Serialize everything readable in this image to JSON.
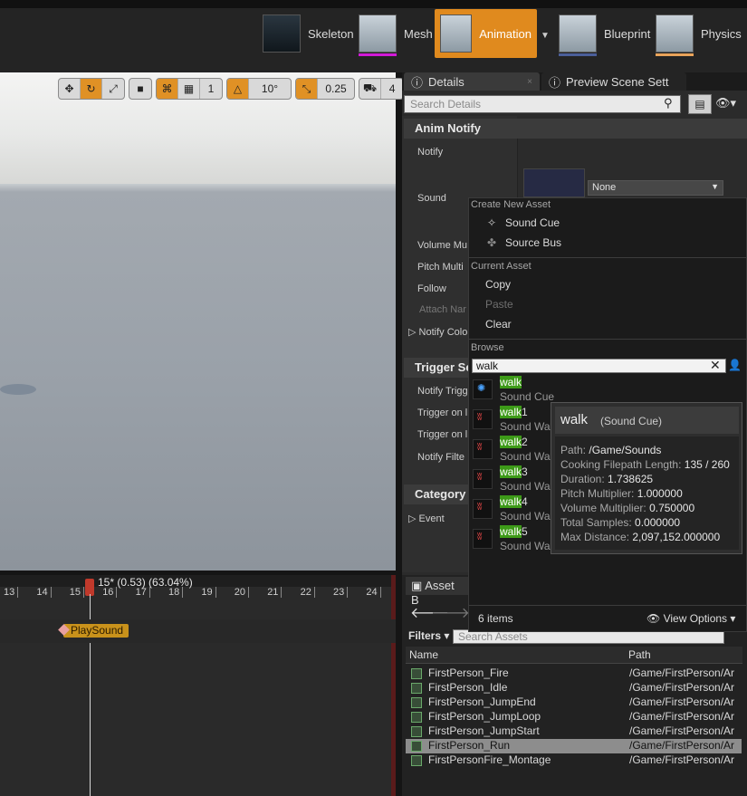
{
  "modes": [
    {
      "label": "Skeleton",
      "accent": "#33a3c8",
      "active": false
    },
    {
      "label": "Mesh",
      "accent": "#d21ad8",
      "active": false
    },
    {
      "label": "Animation",
      "accent": "#e08a1e",
      "active": true
    },
    {
      "label": "Blueprint",
      "accent": "#4b5f9a",
      "active": false
    },
    {
      "label": "Physics",
      "accent": "#e9a35a",
      "active": false
    }
  ],
  "viewport_toolbar": {
    "grid_count": "1",
    "angle": "10°",
    "scale": "0.25",
    "speed": "4"
  },
  "tabs": {
    "details": "Details",
    "preview": "Preview Scene Sett"
  },
  "details": {
    "search_placeholder": "Search Details",
    "sections": {
      "anim_notify": "Anim Notify",
      "trigger": "Trigger Se",
      "category": "Category"
    },
    "props": {
      "notify": "Notify",
      "sound": "Sound",
      "sound_value": "None",
      "volume": "Volume Mu",
      "pitch": "Pitch Multi",
      "follow": "Follow",
      "attach": "Attach Nar",
      "notify_color": "Notify Colo",
      "notify_trigger": "Notify Trigg",
      "trigger_on1": "Trigger on l",
      "trigger_on2": "Trigger on l",
      "notify_filter": "Notify Filte",
      "event": "Event"
    }
  },
  "menu": {
    "create_header": "Create New Asset",
    "sound_cue": "Sound Cue",
    "source_bus": "Source Bus",
    "current_header": "Current Asset",
    "copy": "Copy",
    "paste": "Paste",
    "clear": "Clear",
    "browse_header": "Browse",
    "filter_value": "walk",
    "assets": [
      {
        "hl": "walk",
        "rest": "",
        "type": "Sound Cue"
      },
      {
        "hl": "walk",
        "rest": "1",
        "type": "Sound Wa"
      },
      {
        "hl": "walk",
        "rest": "2",
        "type": "Sound Wa"
      },
      {
        "hl": "walk",
        "rest": "3",
        "type": "Sound Wa"
      },
      {
        "hl": "walk",
        "rest": "4",
        "type": "Sound Wa"
      },
      {
        "hl": "walk",
        "rest": "5",
        "type": "Sound Wa"
      }
    ],
    "count": "6 items",
    "view_options": "View Options"
  },
  "tooltip": {
    "name": "walk",
    "type": "(Sound Cue)",
    "rows": [
      {
        "k": "Path:",
        "v": "/Game/Sounds"
      },
      {
        "k": "Cooking Filepath Length:",
        "v": "135 / 260"
      },
      {
        "k": "Duration:",
        "v": "1.738625"
      },
      {
        "k": "Pitch Multiplier:",
        "v": "1.000000"
      },
      {
        "k": "Volume Multiplier:",
        "v": "0.750000"
      },
      {
        "k": "Total Samples:",
        "v": "0.000000"
      },
      {
        "k": "Max Distance:",
        "v": "2,097,152.000000"
      }
    ]
  },
  "timeline": {
    "playhead": "15* (0.53) (63.04%)",
    "ticks": [
      "13",
      "14",
      "15",
      "16",
      "17",
      "18",
      "19",
      "20",
      "21",
      "22",
      "23",
      "24"
    ],
    "notify": "PlaySound"
  },
  "asset_browser": {
    "title": "Asset B",
    "filters": "Filters",
    "search_placeholder": "Search Assets",
    "col_name": "Name",
    "col_path": "Path",
    "rows": [
      {
        "name": "FirstPerson_Fire",
        "path": "/Game/FirstPerson/Ar"
      },
      {
        "name": "FirstPerson_Idle",
        "path": "/Game/FirstPerson/Ar"
      },
      {
        "name": "FirstPerson_JumpEnd",
        "path": "/Game/FirstPerson/Ar"
      },
      {
        "name": "FirstPerson_JumpLoop",
        "path": "/Game/FirstPerson/Ar"
      },
      {
        "name": "FirstPerson_JumpStart",
        "path": "/Game/FirstPerson/Ar"
      },
      {
        "name": "FirstPerson_Run",
        "path": "/Game/FirstPerson/Ar",
        "selected": true
      },
      {
        "name": "FirstPersonFire_Montage",
        "path": "/Game/FirstPerson/Ar"
      }
    ]
  }
}
